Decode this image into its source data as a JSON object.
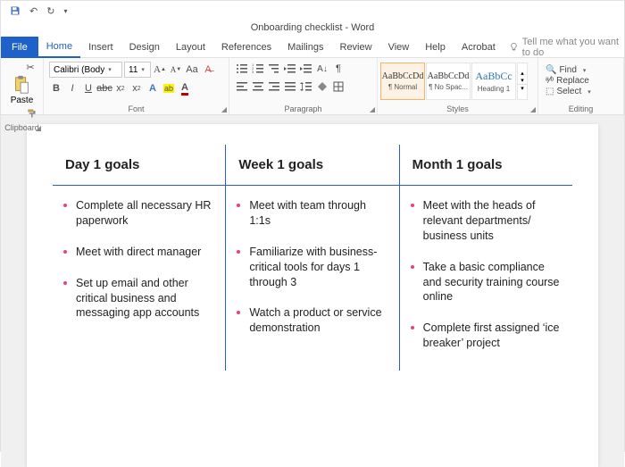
{
  "app": {
    "title": "Onboarding checklist - Word"
  },
  "qat": {
    "save": "save",
    "undo": "undo",
    "redo": "redo"
  },
  "tabs": {
    "file": "File",
    "home": "Home",
    "insert": "Insert",
    "design": "Design",
    "layout": "Layout",
    "references": "References",
    "mailings": "Mailings",
    "review": "Review",
    "view": "View",
    "help": "Help",
    "acrobat": "Acrobat",
    "tellme": "Tell me what you want to do"
  },
  "ribbon": {
    "clipboard": {
      "label": "Clipboard",
      "paste": "Paste"
    },
    "font": {
      "label": "Font",
      "family": "Calibri (Body",
      "size": "11"
    },
    "paragraph": {
      "label": "Paragraph"
    },
    "styles": {
      "label": "Styles",
      "items": [
        {
          "preview": "AaBbCcDd",
          "name": "¶ Normal"
        },
        {
          "preview": "AaBbCcDd",
          "name": "¶ No Spac..."
        },
        {
          "preview": "AaBbCc",
          "name": "Heading 1"
        }
      ]
    },
    "editing": {
      "label": "Editing",
      "find": "Find",
      "replace": "Replace",
      "select": "Select"
    }
  },
  "doc": {
    "columns": [
      {
        "heading": "Day 1 goals",
        "items": [
          "Complete all necessary HR paperwork",
          "Meet with direct manager",
          "Set up email and other critical business and messaging app accounts"
        ]
      },
      {
        "heading": "Week 1 goals",
        "items": [
          "Meet with team through 1:1s",
          "Familiarize with business-critical tools for days 1 through 3",
          "Watch a product or service demonstration"
        ]
      },
      {
        "heading": "Month 1 goals",
        "items": [
          "Meet with the heads of relevant departments/ business units",
          "Take a basic compliance and security training course online",
          "Complete first assigned ‘ice breaker’ project"
        ]
      }
    ]
  }
}
